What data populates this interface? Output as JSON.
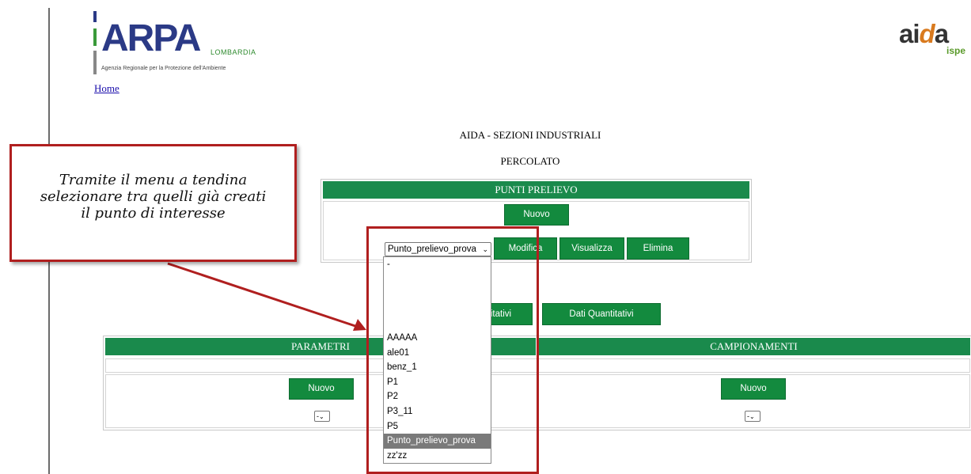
{
  "logo": {
    "brand_text": "ARPA",
    "region": "LOMBARDIA",
    "subtitle": "Agenzia Regionale per la Protezione dell'Ambiente"
  },
  "nav": {
    "home_label": "Home"
  },
  "aida_logo": {
    "prefix": "ai",
    "d": "d",
    "suffix": "a",
    "sub": "ispe"
  },
  "page": {
    "title": "AIDA - SEZIONI INDUSTRIALI",
    "subtitle": "PERCOLATO"
  },
  "punti_prelievo": {
    "header": "PUNTI PRELIEVO",
    "nuovo_label": "Nuovo",
    "selected_value": "Punto_prelievo_prova",
    "modifica_label": "Modifica",
    "visualizza_label": "Visualizza",
    "elimina_label": "Elimina"
  },
  "dati": {
    "qualitativi_label": "Dati Qualitativi",
    "quantitativi_label": "Dati Quantitativi"
  },
  "parametri": {
    "header": "PARAMETRI",
    "nuovo_label": "Nuovo",
    "select_value": "-"
  },
  "campionamenti": {
    "header": "CAMPIONAMENTI",
    "nuovo_label": "Nuovo",
    "select_value": "-"
  },
  "dropdown": {
    "options": [
      "-",
      "",
      "",
      "",
      "",
      "AAAAA",
      "ale01",
      "benz_1",
      "P1",
      "P2",
      "P3_11",
      "P5",
      "Punto_prelievo_prova",
      "zz'zz"
    ],
    "selected_index": 12
  },
  "callout": {
    "text": "Tramite il menu a tendina\nselezionare tra quelli già creati\nil punto di interesse"
  },
  "colors": {
    "green_header": "#1a8a4c",
    "button_green": "#138a3e",
    "annotation_red": "#b01f1f"
  }
}
